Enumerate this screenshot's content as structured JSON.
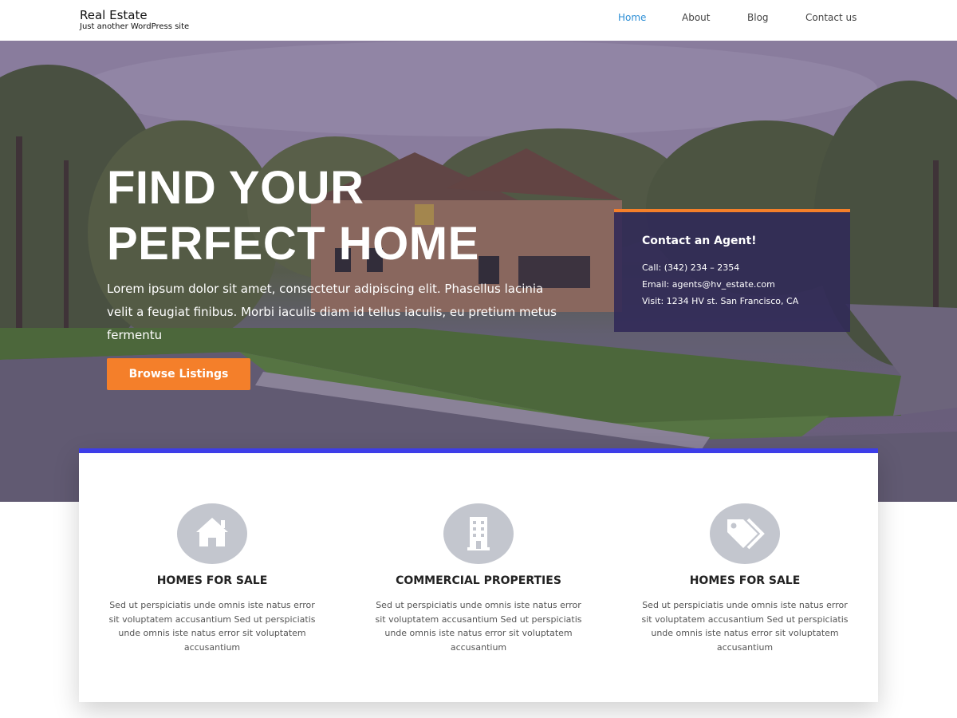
{
  "header": {
    "site_title": "Real Estate",
    "tagline": "Just another WordPress site",
    "nav": [
      {
        "label": "Home",
        "active": true
      },
      {
        "label": "About",
        "active": false
      },
      {
        "label": "Blog",
        "active": false
      },
      {
        "label": "Contact us",
        "active": false
      }
    ]
  },
  "hero": {
    "title_line1": "FIND YOUR",
    "title_line2": "PERFECT HOME",
    "text": "Lorem ipsum dolor sit amet, consectetur adipiscing elit. Phasellus lacinia velit a feugiat finibus. Morbi iaculis diam id tellus iaculis, eu pretium metus fermentu",
    "button_label": "Browse Listings"
  },
  "agent": {
    "title": "Contact an Agent!",
    "call": "Call: (342) 234 – 2354",
    "email": "Email: agents@hv_estate.com",
    "visit": "Visit: 1234 HV st. San Francisco, CA"
  },
  "features": [
    {
      "icon": "home-icon",
      "title": "HOMES FOR SALE",
      "text": "Sed ut perspiciatis unde omnis iste natus error sit voluptatem accusantium Sed ut perspiciatis unde omnis iste natus error sit voluptatem accusantium"
    },
    {
      "icon": "building-icon",
      "title": "COMMERCIAL PROPERTIES",
      "text": "Sed ut perspiciatis unde omnis iste natus error sit voluptatem accusantium Sed ut perspiciatis unde omnis iste natus error sit voluptatem accusantium"
    },
    {
      "icon": "tags-icon",
      "title": "HOMES FOR SALE",
      "text": "Sed ut perspiciatis unde omnis iste natus error sit voluptatem accusantium Sed ut perspiciatis unde omnis iste natus error sit voluptatem accusantium"
    }
  ],
  "colors": {
    "accent_orange": "#f47f2a",
    "nav_active": "#2e8fd6",
    "card_border": "#3d3de8",
    "agent_box": "#302958",
    "icon_circle": "#c3c6ce"
  }
}
